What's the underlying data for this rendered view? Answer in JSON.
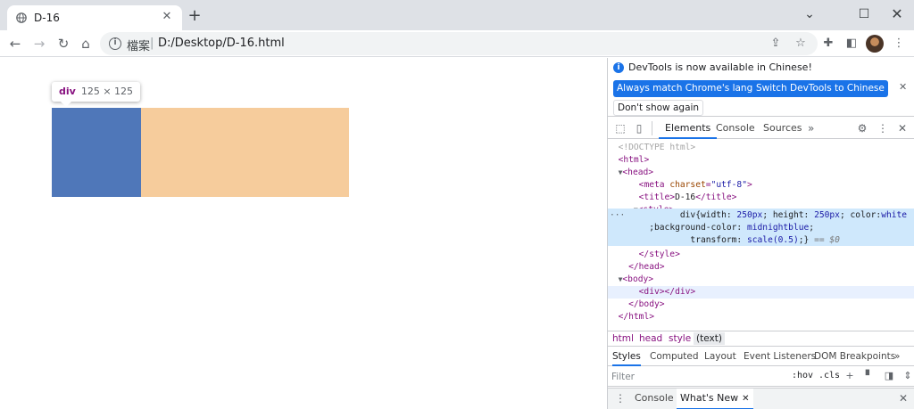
{
  "browser": {
    "tab_title": "D-16",
    "new_tab": "+",
    "url_scheme": "檔案",
    "url": "D:/Desktop/D-16.html"
  },
  "page": {
    "tooltip_tag": "div",
    "tooltip_dims": "125 × 125",
    "colors": {
      "content": "#4f77b9",
      "margin": "#f6cc9c"
    }
  },
  "devtools": {
    "infobar": {
      "message": "DevTools is now available in Chinese!",
      "btn_match": "Always match Chrome's language",
      "btn_switch": "Switch DevTools to Chinese",
      "btn_dont_show": "Don't show again"
    },
    "tabs": [
      "Elements",
      "Console",
      "Sources"
    ],
    "more": "»",
    "dom": {
      "doctype": "<!DOCTYPE html>",
      "html_open": "<html>",
      "head_open": "<head>",
      "meta_tag": "meta",
      "meta_attr": "charset",
      "meta_val": "\"utf-8\"",
      "title_open": "<title>",
      "title_text": "D-16",
      "title_close": "</title>",
      "style_open": "<style>",
      "css_line1_a": "div{width: ",
      "css_line1_b": "250px",
      "css_line1_c": "; height: ",
      "css_line1_d": "250px",
      "css_line1_e": "; color:",
      "css_line1_f": "white",
      "css_line2_a": ";background-color: ",
      "css_line2_b": "midnightblue",
      "css_line2_c": ";",
      "css_line3_a": "transform: ",
      "css_line3_b": "scale(0.5)",
      "css_line3_c": ";}",
      "dollar": "== $0",
      "style_close": "</style>",
      "head_close": "</head>",
      "body_open": "<body>",
      "div_line": "<div></div>",
      "body_close": "</body>",
      "html_close": "</html>",
      "ellipsis": "···"
    },
    "breadcrumbs": [
      "html",
      "head",
      "style",
      "(text)"
    ],
    "subtabs": [
      "Styles",
      "Computed",
      "Layout",
      "Event Listeners",
      "DOM Breakpoints",
      "»"
    ],
    "filter_placeholder": "Filter",
    "hov": ":hov",
    "cls": ".cls",
    "drawer_tabs": [
      "Console",
      "What's New"
    ]
  }
}
